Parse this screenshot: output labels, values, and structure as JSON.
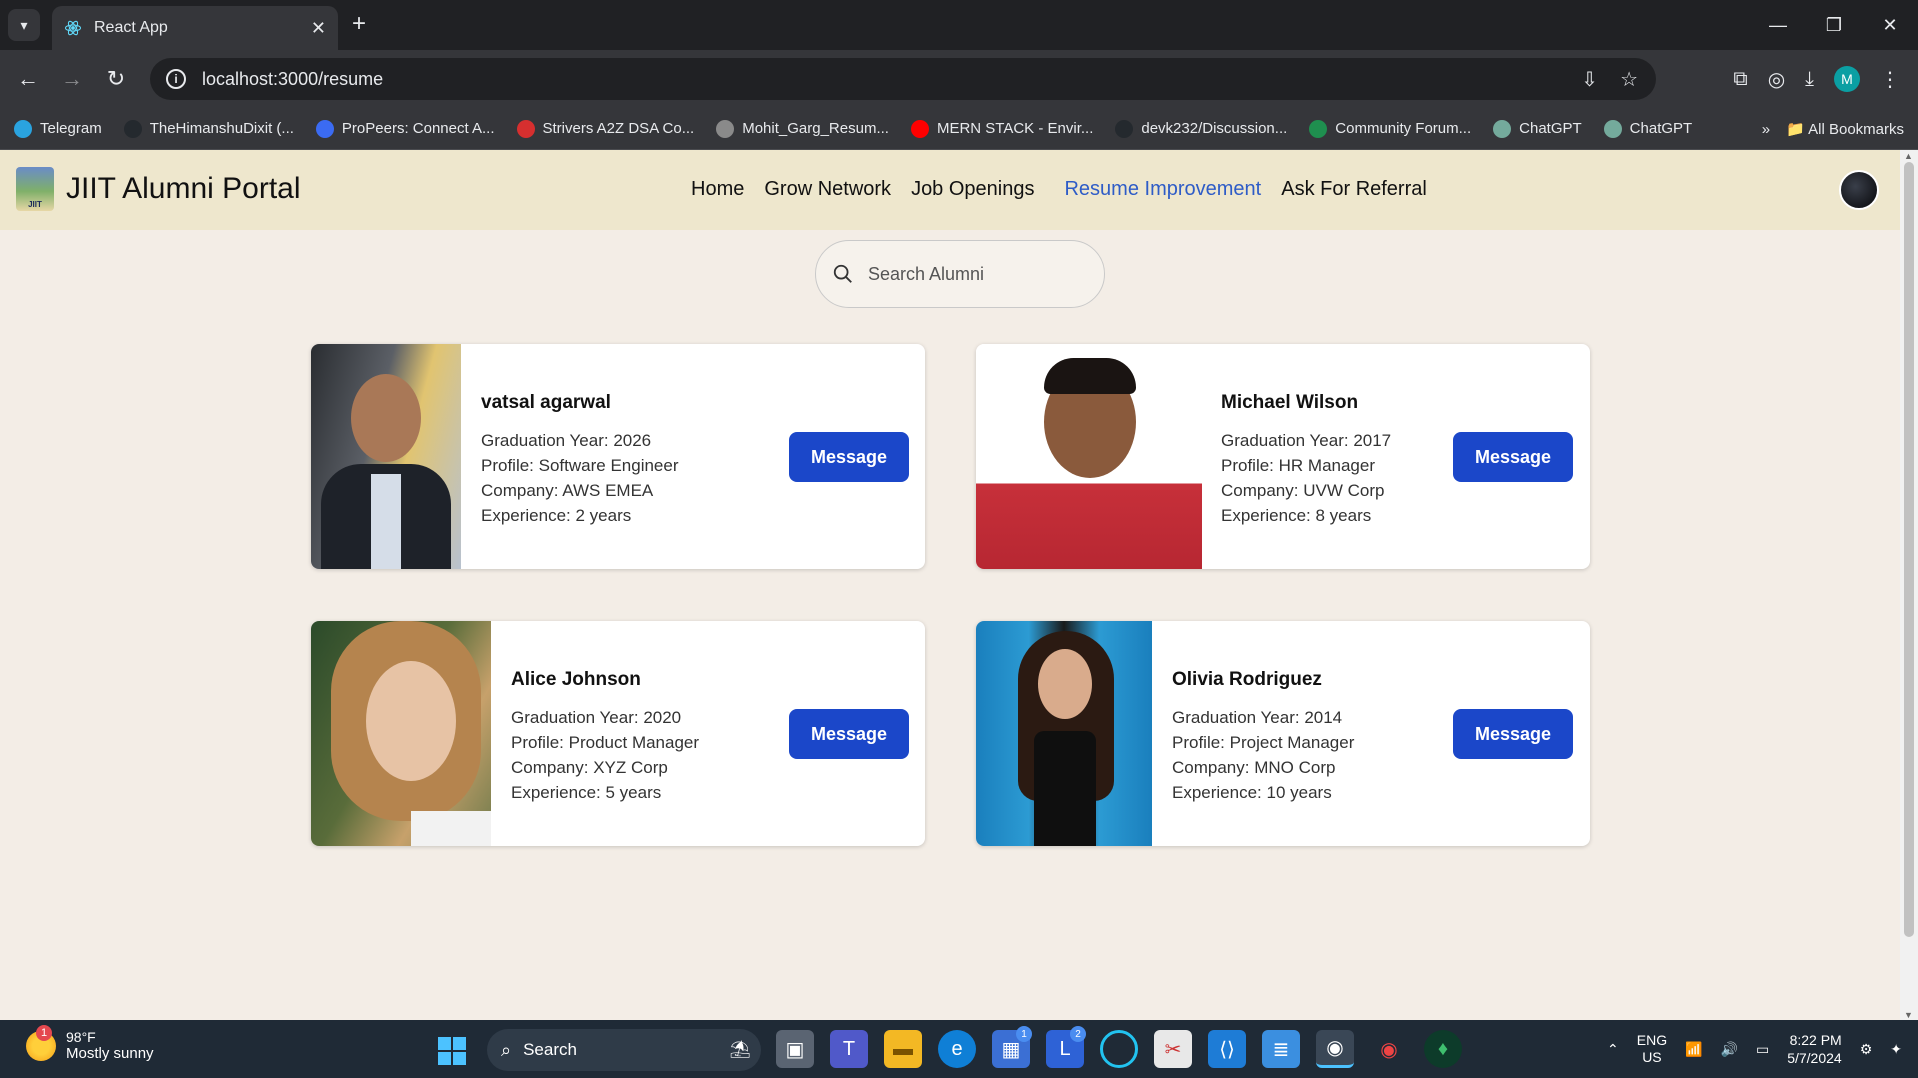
{
  "browser": {
    "tab_title": "React App",
    "url": "localhost:3000/resume",
    "profile_initial": "M",
    "bookmarks": [
      {
        "label": "Telegram",
        "color": "#2aa3df"
      },
      {
        "label": "TheHimanshuDixit (...",
        "color": "#24292e"
      },
      {
        "label": "ProPeers: Connect A...",
        "color": "#3b6bf2"
      },
      {
        "label": "Strivers A2Z DSA Co...",
        "color": "#d62f2f"
      },
      {
        "label": "Mohit_Garg_Resum...",
        "color": "#8a8a8a"
      },
      {
        "label": "MERN STACK - Envir...",
        "color": "#ff0000"
      },
      {
        "label": "devk232/Discussion...",
        "color": "#24292e"
      },
      {
        "label": "Community Forum...",
        "color": "#1f8f4f"
      },
      {
        "label": "ChatGPT",
        "color": "#74aa9c"
      },
      {
        "label": "ChatGPT",
        "color": "#74aa9c"
      }
    ],
    "all_bookmarks": "All Bookmarks"
  },
  "site": {
    "brand": "JIIT Alumni Portal",
    "logo_text": "JIIT",
    "nav": [
      "Home",
      "Grow Network",
      "Job Openings",
      "Resume Improvement",
      "Ask For Referral"
    ],
    "active_nav": "Resume Improvement",
    "accent": "#2e5cc7",
    "button_color": "#1b47c9"
  },
  "search": {
    "placeholder": "Search Alumni"
  },
  "alumni": [
    {
      "name": "vatsal agarwal",
      "graduation": "Graduation Year: 2026",
      "profile": "Profile: Software Engineer",
      "company": "Company: AWS EMEA",
      "experience": "Experience: 2 years",
      "button": "Message"
    },
    {
      "name": "Michael Wilson",
      "graduation": "Graduation Year: 2017",
      "profile": "Profile: HR Manager",
      "company": "Company: UVW Corp",
      "experience": "Experience: 8 years",
      "button": "Message"
    },
    {
      "name": "Alice Johnson",
      "graduation": "Graduation Year: 2020",
      "profile": "Profile: Product Manager",
      "company": "Company: XYZ Corp",
      "experience": "Experience: 5 years",
      "button": "Message"
    },
    {
      "name": "Olivia Rodriguez",
      "graduation": "Graduation Year: 2014",
      "profile": "Profile: Project Manager",
      "company": "Company: MNO Corp",
      "experience": "Experience: 10 years",
      "button": "Message"
    }
  ],
  "taskbar": {
    "weather_badge": "1",
    "temperature": "98°F",
    "condition": "Mostly sunny",
    "search_label": "Search",
    "lang_1": "ENG",
    "lang_2": "US",
    "time": "8:22 PM",
    "date": "5/7/2024",
    "badge_store": "1",
    "badge_l": "2"
  }
}
